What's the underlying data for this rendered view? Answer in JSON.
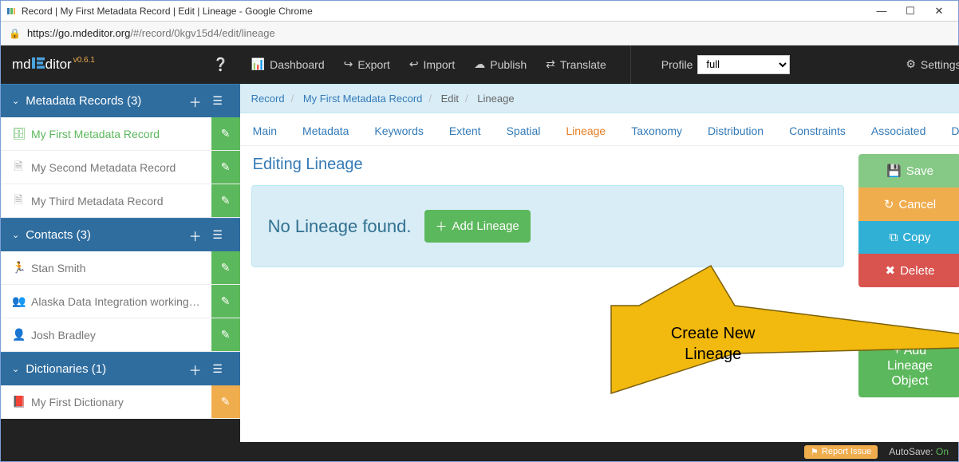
{
  "browser": {
    "title": "Record | My First Metadata Record | Edit | Lineage - Google Chrome",
    "url_host": "https://go.mdeditor.org",
    "url_path": "/#/record/0kgv15d4/edit/lineage"
  },
  "brand": {
    "md": "md",
    "e": "E",
    "ditor": "ditor",
    "version": "v0.6.1"
  },
  "topnav": {
    "dashboard": "Dashboard",
    "export": "Export",
    "import": "Import",
    "publish": "Publish",
    "translate": "Translate",
    "profile_label": "Profile",
    "profile_value": "full",
    "settings": "Settings"
  },
  "sidebar": {
    "records": {
      "title": "Metadata Records (3)",
      "items": [
        {
          "label": "My First Metadata Record",
          "active": true
        },
        {
          "label": "My Second Metadata Record",
          "active": false
        },
        {
          "label": "My Third Metadata Record",
          "active": false
        }
      ]
    },
    "contacts": {
      "title": "Contacts (3)",
      "items": [
        {
          "label": "Stan Smith"
        },
        {
          "label": "Alaska Data Integration working…"
        },
        {
          "label": "Josh Bradley"
        }
      ]
    },
    "dictionaries": {
      "title": "Dictionaries (1)",
      "items": [
        {
          "label": "My First Dictionary"
        }
      ]
    }
  },
  "breadcrumb": {
    "a": "Record",
    "b": "My First Metadata Record",
    "c": "Edit",
    "d": "Lineage"
  },
  "tabs": {
    "main": "Main",
    "metadata": "Metadata",
    "keywords": "Keywords",
    "extent": "Extent",
    "spatial": "Spatial",
    "lineage": "Lineage",
    "taxonomy": "Taxonomy",
    "distribution": "Distribution",
    "constraints": "Constraints",
    "associated": "Associated",
    "last": "D"
  },
  "page": {
    "title": "Editing Lineage",
    "empty_text": "No Lineage found.",
    "add_lineage": "Add Lineage"
  },
  "actions": {
    "save": "Save",
    "cancel": "Cancel",
    "copy": "Copy",
    "delete": "Delete",
    "add_obj_plus": "+ Add",
    "add_obj_l2": "Lineage",
    "add_obj_l3": "Object"
  },
  "callout": {
    "l1": "Create New",
    "l2": "Lineage"
  },
  "footer": {
    "report": "Report Issue",
    "autosave_label": "AutoSave: ",
    "autosave_value": "On"
  }
}
